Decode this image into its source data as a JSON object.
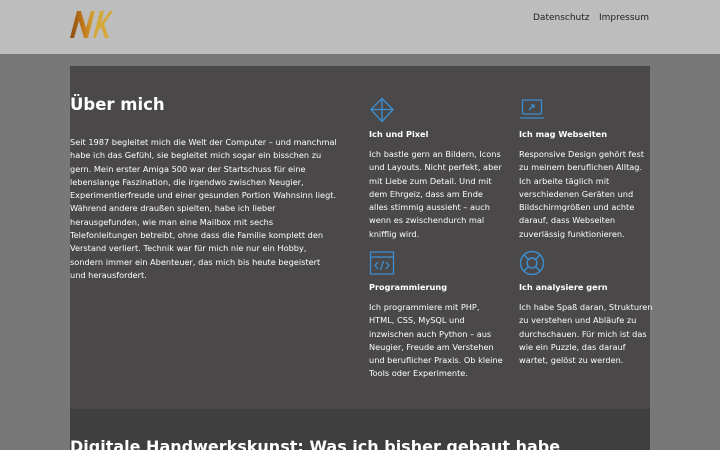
{
  "header": {
    "logo_text": "NK",
    "nav": [
      {
        "label": "Datenschutz"
      },
      {
        "label": "Impressum"
      }
    ]
  },
  "about": {
    "title": "Über mich",
    "text": "Seit 1987 begleitet mich die Welt der Computer – und manchmal habe ich das Gefühl, sie begleitet mich sogar ein bisschen zu gern. Mein erster Amiga 500 war der Startschuss für eine lebenslange Faszination, die irgendwo zwischen Neugier, Experimentierfreude und einer gesunden Portion Wahnsinn liegt. Während andere draußen spielten, habe ich lieber herausgefunden, wie man eine Mailbox mit sechs Telefonleitungen betreibt, ohne dass die Familie komplett den Verstand verliert. Technik war für mich nie nur ein Hobby, sondern immer ein Abenteuer, das mich bis heute begeistert und herausfordert."
  },
  "cards": [
    {
      "icon": "prism-icon",
      "title": "Ich und Pixel",
      "text": "Ich bastle gern an Bildern, Icons und Layouts. Nicht perfekt, aber mit Liebe zum Detail. Und mit dem Ehrgeiz, dass am Ende alles stimmig aussieht – auch wenn es zwischendurch mal knifflig wird."
    },
    {
      "icon": "laptop-icon",
      "title": "Ich mag Webseiten",
      "text": "Responsive Design gehört fest zu meinem beruflichen Alltag. Ich arbeite täglich mit verschiedenen Geräten und Bildschirmgrößen und achte darauf, dass Webseiten zuverlässig funktionieren."
    },
    {
      "icon": "code-window-icon",
      "title": "Programmierung",
      "text": "Ich programmiere mit PHP, HTML, CSS, MySQL und inzwischen auch Python – aus Neugier, Freude am Verstehen und beruflicher Praxis. Ob kleine Tools oder Experimente."
    },
    {
      "icon": "lifebuoy-icon",
      "title": "Ich analysiere gern",
      "text": "Ich habe Spaß daran, Strukturen zu verstehen und Abläufe zu durchschauen. Für mich ist das wie ein Puzzle, das darauf wartet, gelöst zu werden."
    }
  ],
  "section2": {
    "title": "Digitale Handwerkskunst: Was ich bisher gebaut habe"
  },
  "colors": {
    "accent": "#3d8fd1",
    "logo_gold": "#c9a227",
    "logo_brown": "#a05c18",
    "header_bg": "#bdbdbd",
    "section_bg": "#4a4849"
  }
}
